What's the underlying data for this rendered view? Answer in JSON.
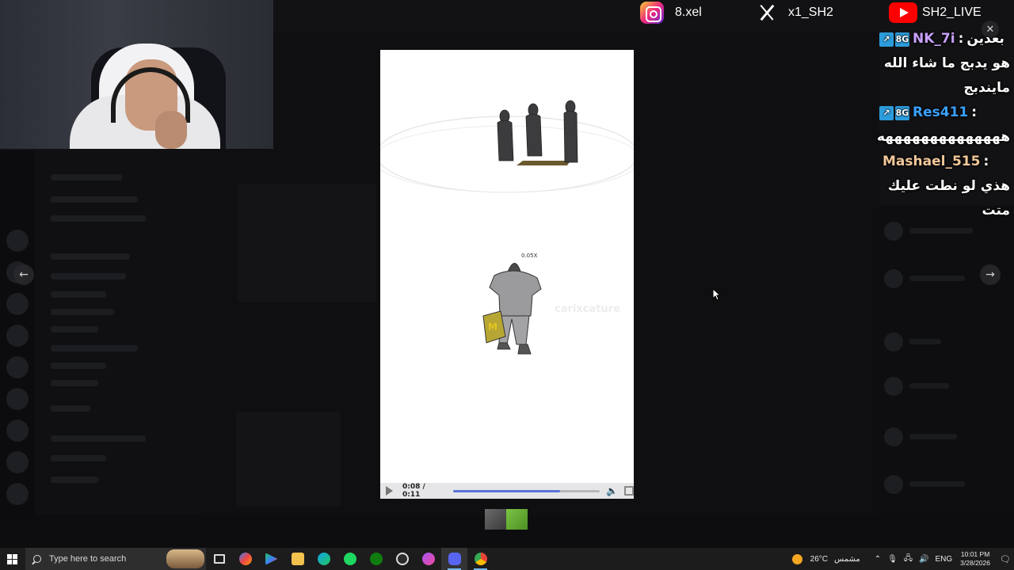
{
  "social": {
    "instagram": "8.xel",
    "x": "x1_SH2",
    "youtube": "SH2_LIVE"
  },
  "icons": {
    "instagram": "instagram-icon",
    "x": "x-logo-icon",
    "youtube": "youtube-icon"
  },
  "chat": [
    {
      "prefix": "بعدين",
      "badge": "↗8G",
      "username": "NK_7i",
      "separator": ":",
      "text": "هو يدبج ما شاء الله مايندبج"
    },
    {
      "badge": "↗8G",
      "username": "Res411",
      "separator": ":",
      "text": "ههههههههههههههه"
    },
    {
      "username": "Mashael_515",
      "separator": ":",
      "text": "هذي لو نطت عليك متت"
    }
  ],
  "video": {
    "watermark": "carixcature",
    "speed_label": "0.05X",
    "time": "0:08 / 0:11",
    "progress": 0.73
  },
  "taskbar": {
    "search_placeholder": "Type here to search",
    "weather_temp": "26°C",
    "weather_text": "مشمس",
    "language": "ENG",
    "time": "10:01 PM",
    "date": "3/28/2026"
  },
  "colors": {
    "chat_name_1": "#c9a0ff",
    "chat_name_2": "#3aa0ff",
    "chat_name_3": "#f2c79a",
    "progress_fill": "#5a73d8",
    "youtube_red": "#ff0000"
  }
}
